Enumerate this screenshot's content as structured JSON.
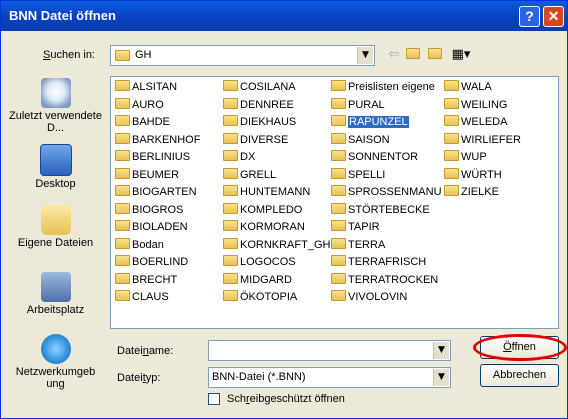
{
  "window": {
    "title": "BNN Datei öffnen",
    "help_icon": "?",
    "close_icon": "✕"
  },
  "lookin": {
    "label_pre": "",
    "label_u": "S",
    "label_post": "uchen in:",
    "value": "GH"
  },
  "sidebar": {
    "items": [
      {
        "label": "Zuletzt verwendete D...",
        "icon": "recent-icon"
      },
      {
        "label": "Desktop",
        "icon": "desktop-icon"
      },
      {
        "label": "Eigene Dateien",
        "icon": "my-documents-icon"
      },
      {
        "label": "Arbeitsplatz",
        "icon": "my-computer-icon"
      },
      {
        "label": "Netzwerkumgeb ung",
        "icon": "network-icon"
      }
    ]
  },
  "folders": {
    "col1": [
      "ALSITAN",
      "AURO",
      "BAHDE",
      "BARKENHOF",
      "BERLINIUS",
      "BEUMER",
      "BIOGARTEN",
      "BIOGROS",
      "BIOLADEN",
      "Bodan",
      "BOERLIND",
      "BRECHT",
      "CLAUS"
    ],
    "col2": [
      "COSILANA",
      "DENNREE",
      "DIEKHAUS",
      "DIVERSE",
      "DX",
      "GRELL",
      "HUNTEMANN",
      "KOMPLEDO",
      "KORMORAN",
      "KORNKRAFT_GH",
      "LOGOCOS",
      "MIDGARD",
      "ÖKOTOPIA"
    ],
    "col3": [
      "Preislisten eigene",
      "PURAL",
      "RAPUNZEL",
      "SAISON",
      "SONNENTOR",
      "SPELLI",
      "SPROSSENMANU",
      "STÖRTEBECKE",
      "TAPIR",
      "TERRA",
      "TERRAFRISCH",
      "TERRATROCKEN",
      "VIVOLOVIN"
    ],
    "col4": [
      "WALA",
      "WEILING",
      "WELEDA",
      "WIRLIEFER",
      "WUP",
      "WÜRTH",
      "ZIELKE"
    ],
    "selected": "RAPUNZEL"
  },
  "filename": {
    "label_pre": "Datei",
    "label_u": "n",
    "label_post": "ame:",
    "value": ""
  },
  "filetype": {
    "label_pre": "Datei",
    "label_u": "t",
    "label_post": "yp:",
    "value": "BNN-Datei (*.BNN)"
  },
  "readonly": {
    "label_pre": "Sch",
    "label_u": "r",
    "label_post": "eibgeschützt öffnen"
  },
  "buttons": {
    "open_u": "Ö",
    "open_rest": "ffnen",
    "cancel": "Abbrechen"
  },
  "colors": {
    "titlebar": "#0842c3",
    "selection": "#316ac5",
    "highlight_ring": "#e00000"
  }
}
